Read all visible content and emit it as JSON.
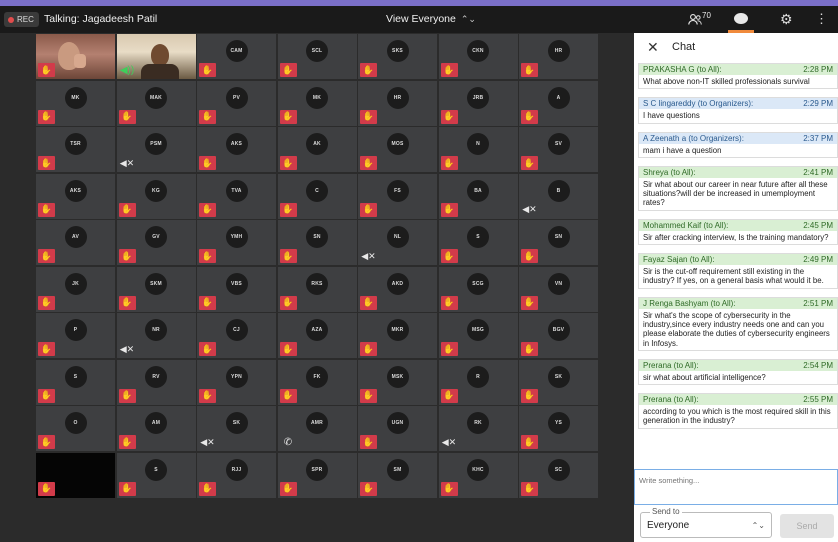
{
  "topbar": {
    "rec_label": "REC",
    "talking": "Talking: Jagadeesh Patil",
    "view_label": "View Everyone",
    "participant_count": "70"
  },
  "tiles": [
    {
      "kind": "video",
      "style": "vf1",
      "status": "muted"
    },
    {
      "kind": "video",
      "style": "vf2",
      "status": "audio"
    },
    {
      "initials": "CAM",
      "status": "muted"
    },
    {
      "initials": "SCL",
      "status": "muted"
    },
    {
      "initials": "SKS",
      "status": "muted"
    },
    {
      "initials": "CKN",
      "status": "muted"
    },
    {
      "initials": "HR",
      "status": "muted"
    },
    {
      "initials": "MK",
      "status": "muted"
    },
    {
      "initials": "MAK",
      "status": "muted"
    },
    {
      "initials": "PV",
      "status": "muted"
    },
    {
      "initials": "MK",
      "status": "muted"
    },
    {
      "initials": "HR",
      "status": "muted"
    },
    {
      "initials": "JRB",
      "status": "muted"
    },
    {
      "initials": "A",
      "status": "muted"
    },
    {
      "initials": "TSR",
      "status": "muted"
    },
    {
      "initials": "PSM",
      "status": "speaker-off"
    },
    {
      "initials": "AKS",
      "status": "muted"
    },
    {
      "initials": "AK",
      "status": "muted"
    },
    {
      "initials": "MOS",
      "status": "muted"
    },
    {
      "initials": "N",
      "status": "muted"
    },
    {
      "initials": "SV",
      "status": "muted"
    },
    {
      "initials": "AKS",
      "status": "muted"
    },
    {
      "initials": "KG",
      "status": "muted"
    },
    {
      "initials": "TVA",
      "status": "muted"
    },
    {
      "initials": "C",
      "status": "muted"
    },
    {
      "initials": "FS",
      "status": "muted"
    },
    {
      "initials": "BA",
      "status": "muted"
    },
    {
      "initials": "B",
      "status": "speaker-off"
    },
    {
      "initials": "AV",
      "status": "muted"
    },
    {
      "initials": "GV",
      "status": "muted"
    },
    {
      "initials": "YMH",
      "status": "muted"
    },
    {
      "initials": "SN",
      "status": "muted"
    },
    {
      "initials": "NL",
      "status": "speaker-off"
    },
    {
      "initials": "S",
      "status": "muted"
    },
    {
      "initials": "SN",
      "status": "muted"
    },
    {
      "initials": "JK",
      "status": "muted"
    },
    {
      "initials": "SKM",
      "status": "muted"
    },
    {
      "initials": "VBS",
      "status": "muted"
    },
    {
      "initials": "RKS",
      "status": "muted"
    },
    {
      "initials": "AKD",
      "status": "muted"
    },
    {
      "initials": "SCG",
      "status": "muted"
    },
    {
      "initials": "VN",
      "status": "muted"
    },
    {
      "initials": "P",
      "status": "muted"
    },
    {
      "initials": "NR",
      "status": "speaker-off"
    },
    {
      "initials": "CJ",
      "status": "muted"
    },
    {
      "initials": "AZA",
      "status": "muted"
    },
    {
      "initials": "MKR",
      "status": "muted"
    },
    {
      "initials": "MSG",
      "status": "muted"
    },
    {
      "initials": "BGV",
      "status": "muted"
    },
    {
      "initials": "S",
      "status": "muted"
    },
    {
      "initials": "RV",
      "status": "muted"
    },
    {
      "initials": "YPN",
      "status": "muted"
    },
    {
      "initials": "FK",
      "status": "muted"
    },
    {
      "initials": "MSK",
      "status": "muted"
    },
    {
      "initials": "R",
      "status": "muted"
    },
    {
      "initials": "SK",
      "status": "muted"
    },
    {
      "initials": "O",
      "status": "muted"
    },
    {
      "initials": "AM",
      "status": "muted"
    },
    {
      "initials": "SK",
      "status": "speaker-off"
    },
    {
      "initials": "AMR",
      "status": "phone"
    },
    {
      "initials": "UGN",
      "status": "muted"
    },
    {
      "initials": "RK",
      "status": "speaker-off"
    },
    {
      "initials": "YS",
      "status": "muted"
    },
    {
      "kind": "black",
      "status": "muted"
    },
    {
      "initials": "S",
      "status": "muted"
    },
    {
      "initials": "RJJ",
      "status": "muted"
    },
    {
      "initials": "SPR",
      "status": "muted"
    },
    {
      "initials": "SM",
      "status": "muted"
    },
    {
      "initials": "KHC",
      "status": "muted"
    },
    {
      "initials": "SC",
      "status": "muted"
    }
  ],
  "chat": {
    "title": "Chat",
    "messages": [
      {
        "sender": "PRAKASHA G (to All):",
        "time": "2:28 PM",
        "text": "What above non-IT skilled professionals survival",
        "tone": "green"
      },
      {
        "sender": "S C lingareddy (to Organizers):",
        "time": "2:29 PM",
        "text": "I have questions",
        "tone": "blue"
      },
      {
        "sender": "A Zeenath a (to Organizers):",
        "time": "2:37 PM",
        "text": "mam i have a question",
        "tone": "blue"
      },
      {
        "sender": "Shreya (to All):",
        "time": "2:41 PM",
        "text": "Sir what about our career in near future after all these situations?will der be increased in umemployment rates?",
        "tone": "green"
      },
      {
        "sender": "Mohammed Kaif (to All):",
        "time": "2:45 PM",
        "text": "Sir after cracking interview, Is the training mandatory?",
        "tone": "green"
      },
      {
        "sender": "Fayaz Sajan (to All):",
        "time": "2:49 PM",
        "text": "Sir is the cut-off requirement still existing in the industry? If yes, on a general basis what would it be.",
        "tone": "green"
      },
      {
        "sender": "J Renga Bashyam (to All):",
        "time": "2:51 PM",
        "text": "Sir what's the scope of cybersecurity in the industry,since every industry needs one and can you please elaborate the duties of cybersecurity engineers in Infosys.",
        "tone": "green"
      },
      {
        "sender": "Prerana (to All):",
        "time": "2:54 PM",
        "text": "sir what about artificial intelligence?",
        "tone": "green"
      },
      {
        "sender": "Prerana (to All):",
        "time": "2:55 PM",
        "text": "according to you which is the most required skill in this generation in the industry?",
        "tone": "green"
      }
    ],
    "compose_placeholder": "Write something...",
    "send_to_label": "Send to",
    "send_to_value": "Everyone",
    "send_label": "Send"
  }
}
